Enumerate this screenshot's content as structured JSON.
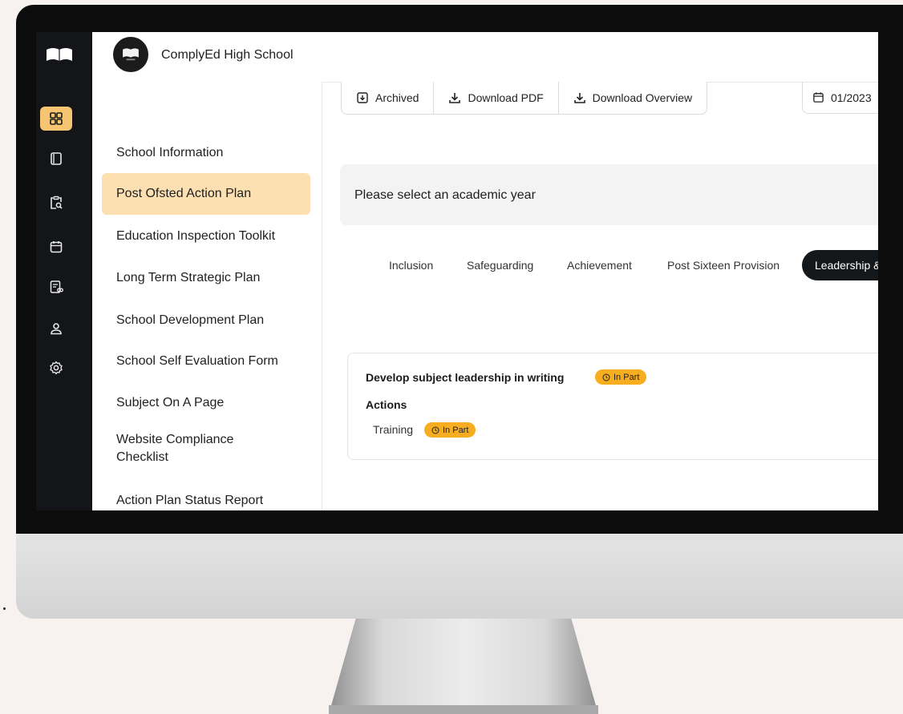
{
  "school": {
    "name": "ComplyEd High School"
  },
  "sidebar": {
    "items": [
      {
        "label": "School Information"
      },
      {
        "label": "Post Ofsted Action Plan",
        "active": true
      },
      {
        "label": "Education Inspection Toolkit"
      },
      {
        "label": "Long Term Strategic Plan"
      },
      {
        "label": "School Development Plan"
      },
      {
        "label": "School Self Evaluation Form"
      },
      {
        "label": "Subject On A Page"
      },
      {
        "label": "Website Compliance Checklist"
      },
      {
        "label": "Action Plan Status Report"
      }
    ]
  },
  "rail": {
    "icons": [
      "book-logo-icon",
      "dashboard-icon",
      "document-icon",
      "clipboard-search-icon",
      "calendar-icon",
      "report-icon",
      "user-icon",
      "settings-icon"
    ]
  },
  "toolbar": {
    "archived_label": "Archived",
    "download_pdf_label": "Download PDF",
    "download_overview_label": "Download Overview"
  },
  "date_field": {
    "value": "01/2023"
  },
  "banner": {
    "text": "Please select an academic year"
  },
  "tabs": [
    {
      "label": "Inclusion"
    },
    {
      "label": "Safeguarding"
    },
    {
      "label": "Achievement"
    },
    {
      "label": "Post Sixteen Provision"
    },
    {
      "label": "Leadership & Gov",
      "active": true
    }
  ],
  "card": {
    "title": "Develop subject leadership in writing",
    "status": "In Part",
    "actions_heading": "Actions",
    "actions": [
      {
        "name": "Training",
        "status": "In Part"
      }
    ]
  },
  "colors": {
    "accent": "#f6c572",
    "active_nav": "#fde0b2",
    "badge": "#f6ad1f",
    "rail": "#131518"
  }
}
